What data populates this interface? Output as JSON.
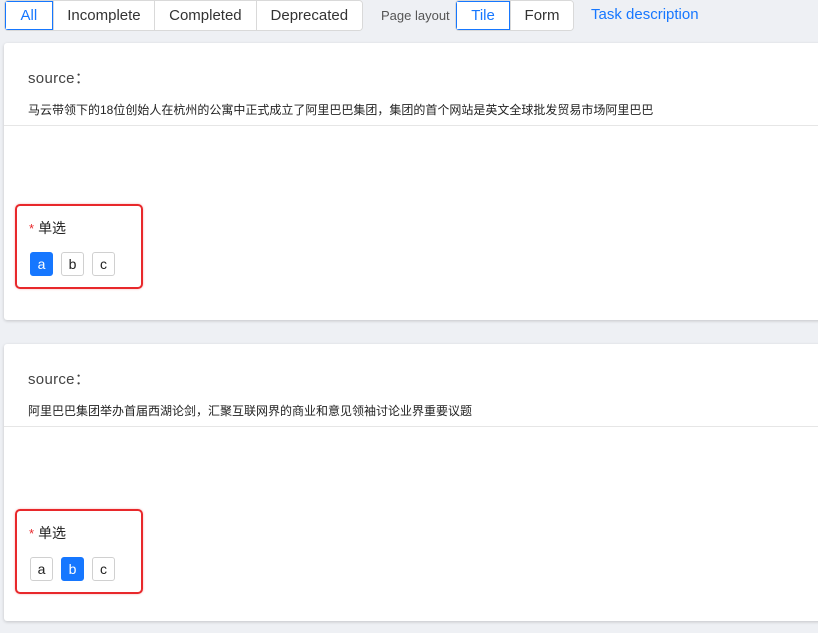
{
  "filters": [
    "All",
    "Incomplete",
    "Completed",
    "Deprecated"
  ],
  "active_filter": "All",
  "page_layout": {
    "label": "Page layout",
    "options": [
      "Tile",
      "Form"
    ],
    "active": "Tile"
  },
  "task_description_link": "Task description",
  "cards": [
    {
      "source_label": "source：",
      "source_text": "马云带领下的18位创始人在杭州的公寓中正式成立了阿里巴巴集团，集团的首个网站是英文全球批发贸易市场阿里巴巴",
      "question": {
        "required_mark": "*",
        "title": "单选",
        "options": [
          "a",
          "b",
          "c"
        ],
        "selected": "a"
      }
    },
    {
      "source_label": "source：",
      "source_text": "阿里巴巴集团举办首届西湖论剑，汇聚互联网界的商业和意见领袖讨论业界重要议题",
      "question": {
        "required_mark": "*",
        "title": "单选",
        "options": [
          "a",
          "b",
          "c"
        ],
        "selected": "b"
      }
    }
  ]
}
